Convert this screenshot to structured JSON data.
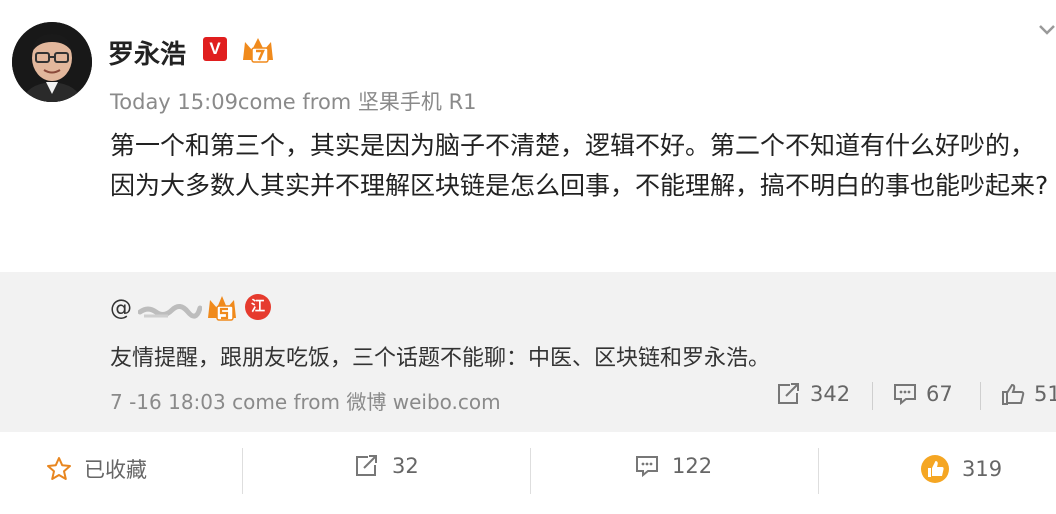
{
  "post": {
    "username": "罗永浩",
    "verified_badge": "V",
    "meta": "Today 15:09come from 坚果手机 R1",
    "content": "第一个和第三个，其实是因为脑子不清楚，逻辑不好。第二个不知道有什么好吵的，因为大多数人其实并不理解区块链是怎么回事，不能理解，搞不明白的事也能吵起来?"
  },
  "repost": {
    "user_prefix": "@",
    "badge_text": "江",
    "text": "友情提醒，跟朋友吃饭，三个话题不能聊：中医、区块链和罗永浩。",
    "meta": "7 -16 18:03 come from 微博 weibo.com",
    "share_count": "342",
    "comment_count": "67",
    "like_count": "51"
  },
  "footer": {
    "favorite_label": "已收藏",
    "share_count": "32",
    "comment_count": "122",
    "like_count": "319"
  },
  "icons": {
    "header_chevron": "chevron-down-icon",
    "crown": "crown-badge-icon",
    "favorite": "star-icon",
    "share": "share-icon",
    "comment": "comment-icon",
    "like": "thumbs-up-icon"
  },
  "colors": {
    "badge_red": "#e01e1e",
    "crown_orange": "#f08a1c",
    "like_orange": "#f5a623",
    "repost_bg": "#f2f2f2"
  }
}
